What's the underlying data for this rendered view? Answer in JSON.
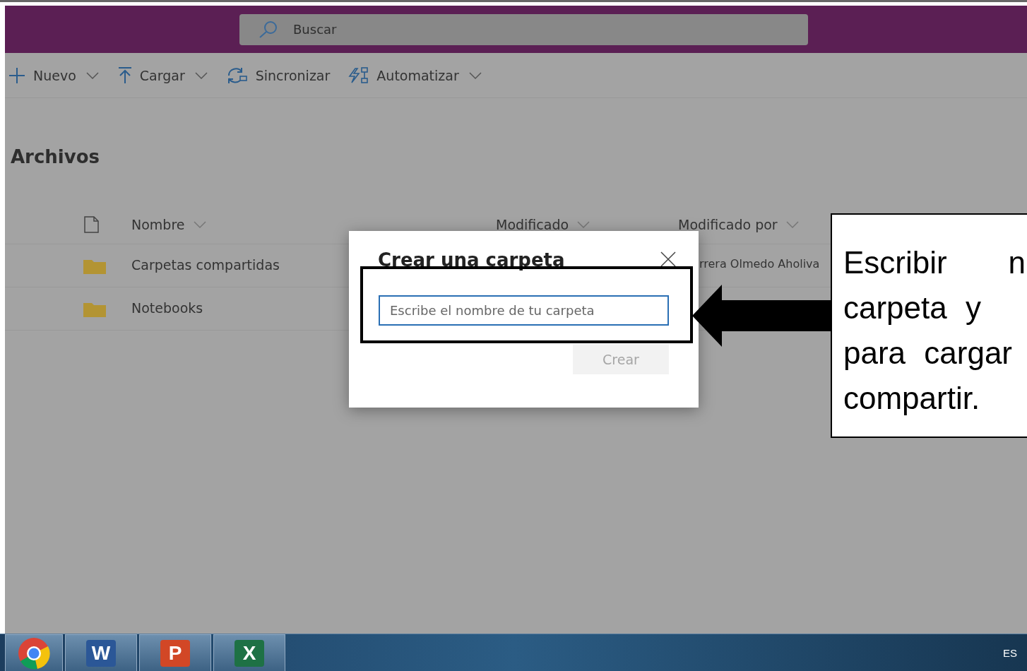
{
  "search": {
    "placeholder": "Buscar"
  },
  "toolbar": [
    {
      "label": "Nuevo",
      "kind": "plus",
      "dropdown": true
    },
    {
      "label": "Cargar",
      "kind": "upload",
      "dropdown": true
    },
    {
      "label": "Sincronizar",
      "kind": "sync",
      "dropdown": false
    },
    {
      "label": "Automatizar",
      "kind": "flow",
      "dropdown": true
    }
  ],
  "page_title": "Archivos",
  "table": {
    "columns": [
      {
        "label": "Nombre"
      },
      {
        "label": "Modificado"
      },
      {
        "label": "Modificado por"
      }
    ],
    "rows": [
      {
        "name": "Carpetas compartidas",
        "modified_by": "rrera Olmedo Aholiva"
      },
      {
        "name": "Notebooks"
      }
    ]
  },
  "dialog": {
    "title": "Crear una carpeta",
    "input": {
      "placeholder": "Escribe el nombre de tu carpeta"
    },
    "button": {
      "label": "Crear",
      "disabled": true
    }
  },
  "callout": {
    "lines": [
      "Escribir n",
      "carpeta y",
      "para cargar",
      "compartir."
    ]
  },
  "taskbar": {
    "apps": [
      {
        "kind": "chrome"
      },
      {
        "kind": "word",
        "letter": "W"
      },
      {
        "kind": "powerpoint",
        "letter": "P"
      },
      {
        "kind": "excel",
        "letter": "X"
      }
    ],
    "language": "ES"
  }
}
